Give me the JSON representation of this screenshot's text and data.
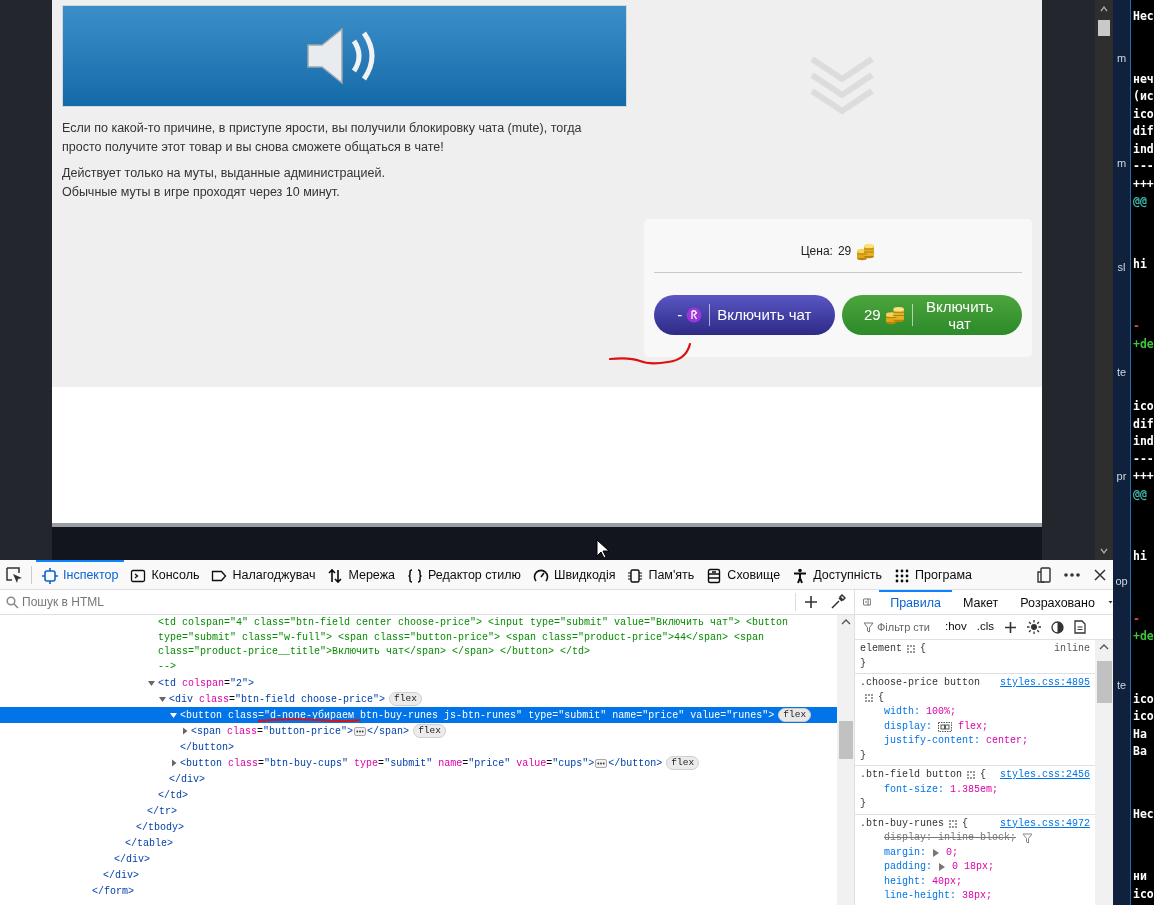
{
  "page": {
    "paragraphs": [
      [
        "Если по какой-то причине, в приступе ярости, вы получили блокировку чата (mute), тогда просто получите этот товар и вы снова сможете общаться в чате!"
      ],
      [
        "Действует только на муты, выданные администрацией.",
        "Обычные муты в игре проходят через 10 минут."
      ]
    ],
    "price": {
      "label": "Цена:",
      "value": "29"
    },
    "buttons": [
      {
        "kind": "runes",
        "amount": "-",
        "label": "Включить чат"
      },
      {
        "kind": "cups",
        "amount": "29",
        "label": "Включить чат"
      }
    ]
  },
  "devtools": {
    "tabs": [
      {
        "kind": "inspector",
        "label": "Інспектор",
        "selected": true
      },
      {
        "kind": "console",
        "label": "Консоль",
        "selected": false
      },
      {
        "kind": "debugger",
        "label": "Налагоджувач",
        "selected": false
      },
      {
        "kind": "network",
        "label": "Мережа",
        "selected": false
      },
      {
        "kind": "style",
        "label": "Редактор стилю",
        "selected": false
      },
      {
        "kind": "performance",
        "label": "Швидкодія",
        "selected": false
      },
      {
        "kind": "memory",
        "label": "Пам'ять",
        "selected": false
      },
      {
        "kind": "storage",
        "label": "Сховище",
        "selected": false
      },
      {
        "kind": "accessibility",
        "label": "Доступність",
        "selected": false
      },
      {
        "kind": "application",
        "label": "Програма",
        "selected": false
      }
    ],
    "search": {
      "placeholder": "Пошук в HTML"
    },
    "tree": {
      "kind": "element",
      "close": "</form>",
      "selected": false,
      "children": [
        {
          "kind": "element",
          "close": "</div>",
          "selected": false,
          "children": [
            {
              "kind": "element",
              "close": "</div>",
              "selected": false,
              "children": [
                {
                  "kind": "element",
                  "close": "</table>",
                  "selected": false,
                  "children": [
                    {
                      "kind": "element",
                      "close": "</tbody>",
                      "selected": false,
                      "children": [
                        {
                          "kind": "element",
                          "close": "</tr>",
                          "selected": false,
                          "children": [
                            {
                              "kind": "comment",
                              "lines": [
                                "<td colspan=\"4\" class=\"btn-field center choose-price\"> <input type=\"submit\" value=\"Включить чат\"> <button",
                                "type=\"submit\" class=\"w-full\"> <span class=\"button-price\"> <span class=\"product-price\">44</span> <span",
                                "class=\"product-price__title\">Включить чат</span> </span> </button> </td>",
                                "-->"
                              ]
                            },
                            {
                              "kind": "element",
                              "open": "<td colspan=\"2\">",
                              "close": "</td>",
                              "expanded": true,
                              "selected": false,
                              "children": [
                                {
                                  "kind": "element",
                                  "open": "<div class=\"btn-field choose-price\">",
                                  "badge": "flex",
                                  "close": "</div>",
                                  "expanded": true,
                                  "selected": false,
                                  "children": [
                                    {
                                      "kind": "element",
                                      "open": "<button class=\"d-none-убираем btn-buy-runes js-btn-runes\" type=\"submit\" name=\"price\" value=\"runes\">",
                                      "badge": "flex",
                                      "close": "</button>",
                                      "expanded": true,
                                      "selected": true,
                                      "children": [
                                        {
                                          "kind": "element",
                                          "open": "<span class=\"button-price\">",
                                          "close": "</span>",
                                          "badge": "flex",
                                          "expanded": false,
                                          "selected": false
                                        }
                                      ]
                                    },
                                    {
                                      "kind": "element",
                                      "open": "<button class=\"btn-buy-cups\" type=\"submit\" name=\"price\" value=\"cups\">",
                                      "close": "</button>",
                                      "badge": "flex",
                                      "expanded": false,
                                      "selected": false
                                    }
                                  ]
                                }
                              ]
                            }
                          ]
                        }
                      ]
                    }
                  ]
                }
              ]
            }
          ]
        }
      ]
    },
    "sidebar_tabs": [
      {
        "label": "Правила",
        "selected": true
      },
      {
        "label": "Макет",
        "selected": false
      },
      {
        "label": "Розраховано",
        "selected": false
      }
    ],
    "filter": {
      "placeholder": "Фільтр сти",
      "toggles": [
        ":hov",
        ".cls"
      ]
    },
    "rules": [
      {
        "selector": "element",
        "open": "{",
        "close": "}",
        "source": "inline",
        "link": false
      },
      {
        "selector": ".choose-price button",
        "open": "{",
        "close": "}",
        "source": "styles.css:4895",
        "link": true,
        "declarations": [
          {
            "text": "width: 100%;",
            "kind": "plain",
            "overridden": false
          },
          {
            "text": "display: flex;",
            "kind": "flex",
            "overridden": false
          },
          {
            "text": "justify-content: center;",
            "kind": "plain",
            "overridden": false
          }
        ]
      },
      {
        "selector": ".btn-field button",
        "open": "{",
        "close": "}",
        "source": "styles.css:2456",
        "link": true,
        "declarations": [
          {
            "text": "font-size: 1.385em;",
            "kind": "plain",
            "overridden": false
          }
        ]
      },
      {
        "selector": ".btn-buy-runes",
        "open": "{",
        "source": "styles.css:4972",
        "link": true,
        "declarations": [
          {
            "text": "display: inline-block;",
            "kind": "plain",
            "overridden": true
          },
          {
            "text": "margin: 0;",
            "kind": "expandable",
            "overridden": false
          },
          {
            "text": "padding: 0 18px;",
            "kind": "expandable",
            "overridden": false
          },
          {
            "text": "height: 40px;",
            "kind": "plain",
            "overridden": false
          },
          {
            "text": "line-height: 38px;",
            "kind": "plain",
            "overridden": false
          }
        ]
      }
    ]
  },
  "side_window": {
    "column_a": [
      "m",
      "m",
      "sl",
      "te",
      "pr",
      "op",
      "te"
    ],
    "column_b": [
      [
        {
          "text": "Нес",
          "color": "#ffffff"
        }
      ],
      [
        {
          "text": "неч",
          "color": "#ffffff"
        },
        {
          "text": "(ис",
          "color": "#ffffff"
        },
        {
          "text": "ico",
          "color": "#ffffff"
        },
        {
          "text": "dif",
          "color": "#ffffff"
        },
        {
          "text": "ind",
          "color": "#ffffff"
        },
        {
          "text": "---",
          "color": "#ffffff"
        },
        {
          "text": "+++",
          "color": "#ffffff"
        },
        {
          "text": "@@",
          "color": "#3fb8af"
        }
      ],
      [
        {
          "text": "hi",
          "color": "#ffffff"
        }
      ],
      [
        {
          "text": "-",
          "color": "#e0443e"
        },
        {
          "text": "+de",
          "color": "#3ec43e"
        }
      ],
      [
        {
          "text": "ico",
          "color": "#ffffff"
        },
        {
          "text": "dif",
          "color": "#ffffff"
        },
        {
          "text": "ind",
          "color": "#ffffff"
        },
        {
          "text": "---",
          "color": "#ffffff"
        },
        {
          "text": "+++",
          "color": "#ffffff"
        },
        {
          "text": "@@",
          "color": "#3fb8af"
        }
      ],
      [
        {
          "text": "hi",
          "color": "#ffffff"
        }
      ],
      [
        {
          "text": "-",
          "color": "#e0443e"
        },
        {
          "text": "+de",
          "color": "#3ec43e"
        }
      ],
      [
        {
          "text": "ico",
          "color": "#ffffff"
        },
        {
          "text": "ico",
          "color": "#ffffff"
        },
        {
          "text": "На",
          "color": "#ffffff"
        },
        {
          "text": "Ba",
          "color": "#ffffff"
        }
      ],
      [
        {
          "text": "Нес",
          "color": "#ffffff"
        }
      ],
      [
        {
          "text": "ни",
          "color": "#ffffff"
        },
        {
          "text": "ico",
          "color": "#ffffff"
        }
      ]
    ]
  }
}
